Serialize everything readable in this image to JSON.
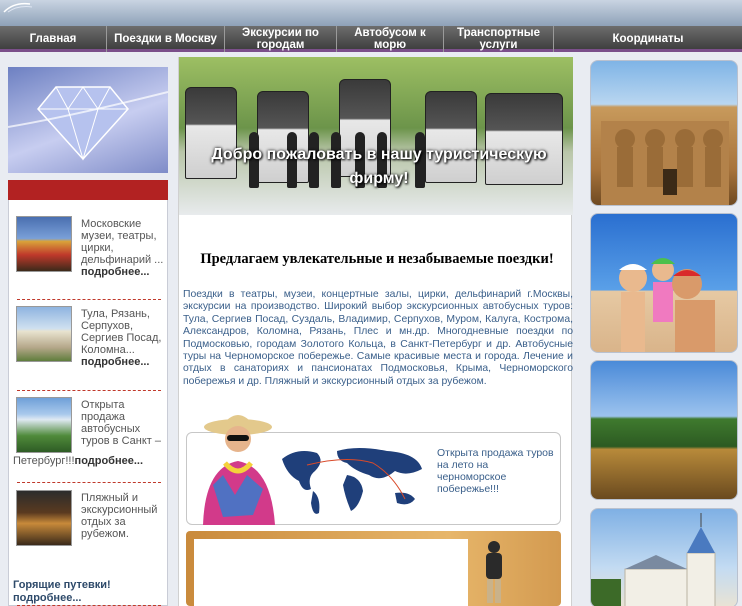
{
  "nav": {
    "items": [
      {
        "label": "Главная"
      },
      {
        "label": "Поездки в Москву"
      },
      {
        "label": "Экскурсии по городам"
      },
      {
        "label": "Автобусом к морю"
      },
      {
        "label": "Транспортные услуги"
      },
      {
        "label": "Координаты"
      }
    ]
  },
  "banner": {
    "welcome": "Добро пожаловать в нашу туристическую фирму!"
  },
  "news": [
    {
      "text": "Московские музеи, театры, цирки, дельфинарий ...",
      "more": "подробнее..."
    },
    {
      "text": "Тула, Рязань, Серпухов, Сергиев Посад, Коломна...",
      "more": "подробнее..."
    },
    {
      "text_a": "Открыта продажа автобусных туров в Санкт –",
      "text_b": "Петербург!!!",
      "more": "подробнее..."
    },
    {
      "text": "Пляжный и экскурсионный отдых за рубежом."
    }
  ],
  "hot": {
    "label": "Горящие путевки!",
    "more": "подробнее..."
  },
  "main": {
    "heading": "Предлагаем увлекательные и незабываемые поездки!",
    "intro": "Поездки в театры, музеи, концертные залы, цирки, дельфинарий г.Москвы, экскурсии на производство. Широкий выбор экскурсионных автобусных туров: Тула, Сергиев Посад, Суздаль, Владимир, Серпухов, Муром, Калуга, Кострома, Александров, Коломна, Рязань, Плес и мн.др. Многодневные поездки по Подмосковью, городам Золотого Кольца, в Санкт-Петербург и др. Автобусные туры на Черноморское побережье. Самые красивые места и города. Лечение и отдых в санаториях и пансионатах Подмосковья, Крыма, Черноморского побережья и др. Пляжный и экскурсионный отдых за рубежом.",
    "promo": "Открыта продажа туров на лето на черноморское побережье!!!"
  },
  "colors": {
    "nav_bg": "#4a4a4a",
    "accent_red": "#b22222",
    "link_blue": "#3a5f8a"
  }
}
